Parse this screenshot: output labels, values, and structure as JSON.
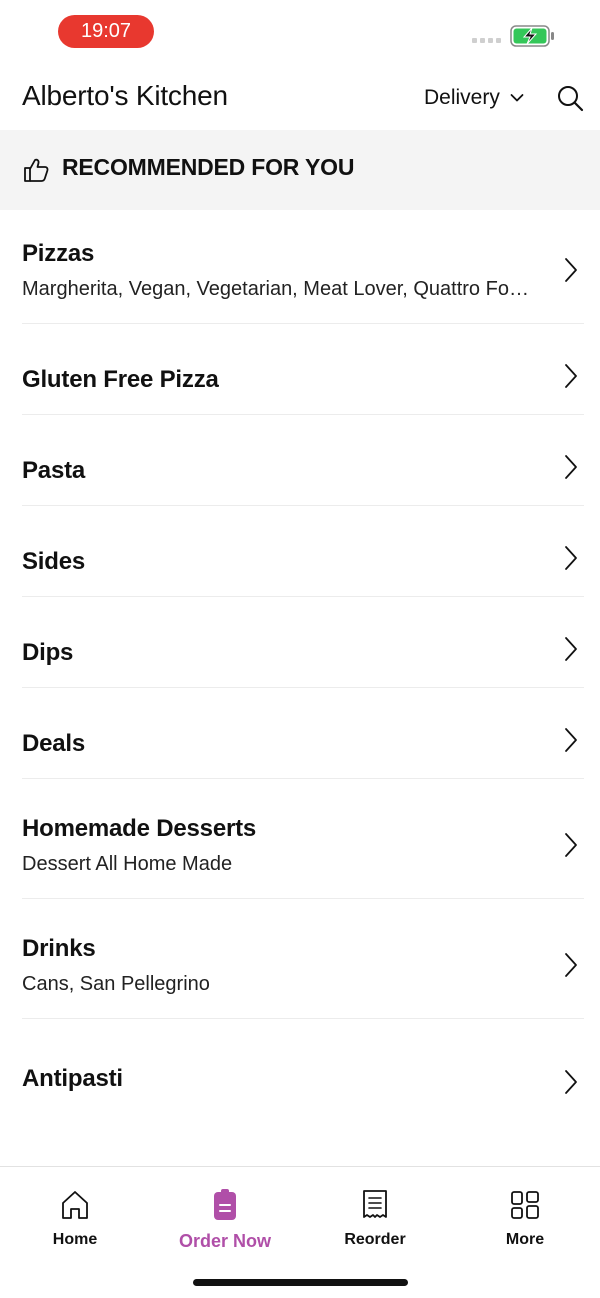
{
  "status_bar": {
    "time": "19:07",
    "time_pill_color": "#e8382f",
    "battery_color": "#34c759"
  },
  "header": {
    "title": "Alberto's Kitchen",
    "mode_label": "Delivery",
    "mode_icon": "chevron-down-icon",
    "search_icon": "search-icon"
  },
  "recommended": {
    "label": "RECOMMENDED FOR YOU",
    "icon": "thumbs-up-icon"
  },
  "menu": [
    {
      "title": "Pizzas",
      "subtitle": "Margherita, Vegan, Vegetarian, Meat Lover, Quattro Formaggi"
    },
    {
      "title": "Gluten Free Pizza",
      "subtitle": ""
    },
    {
      "title": "Pasta",
      "subtitle": ""
    },
    {
      "title": "Sides",
      "subtitle": ""
    },
    {
      "title": "Dips",
      "subtitle": ""
    },
    {
      "title": "Deals",
      "subtitle": ""
    },
    {
      "title": "Homemade Desserts",
      "subtitle": "Dessert All Home Made"
    },
    {
      "title": "Drinks",
      "subtitle": "Cans, San Pellegrino"
    },
    {
      "title": "Antipasti",
      "subtitle": ""
    }
  ],
  "tabs": [
    {
      "label": "Home",
      "icon": "home-icon",
      "active": false
    },
    {
      "label": "Order Now",
      "icon": "order-now-icon",
      "active": true
    },
    {
      "label": "Reorder",
      "icon": "receipt-icon",
      "active": false
    },
    {
      "label": "More",
      "icon": "grid-icon",
      "active": false
    }
  ],
  "accent_color": "#b04fa8"
}
